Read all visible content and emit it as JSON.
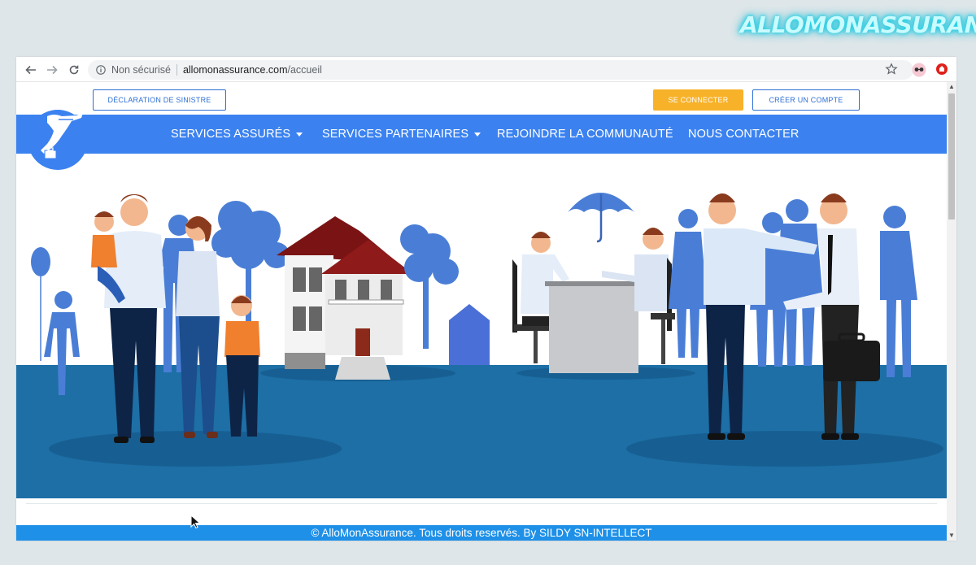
{
  "brand": {
    "text": "ALLOMONASSURANCE"
  },
  "browser": {
    "security_label": "Non sécurisé",
    "url_host": "allomonassurance.com",
    "url_path": "/accueil"
  },
  "header": {
    "declaration_label": "DÉCLARATION DE SINISTRE",
    "login_label": "SE CONNECTER",
    "signup_label": "CRÉER UN COMPTE"
  },
  "nav": {
    "items": [
      {
        "label": "SERVICES ASSURÉS",
        "has_dropdown": true
      },
      {
        "label": "SERVICES PARTENAIRES",
        "has_dropdown": true
      },
      {
        "label": "REJOINDRE LA COMMUNAUTÉ",
        "has_dropdown": false
      },
      {
        "label": "NOUS CONTACTER",
        "has_dropdown": false
      }
    ]
  },
  "footer": {
    "text": "© AlloMonAssurance. Tous droits reservés. By SILDY SN-INTELLECT"
  },
  "colors": {
    "navbar": "#3b82f0",
    "accent_yellow": "#f7b22a",
    "footer": "#1e90e8",
    "ground": "#1d6fa6"
  }
}
